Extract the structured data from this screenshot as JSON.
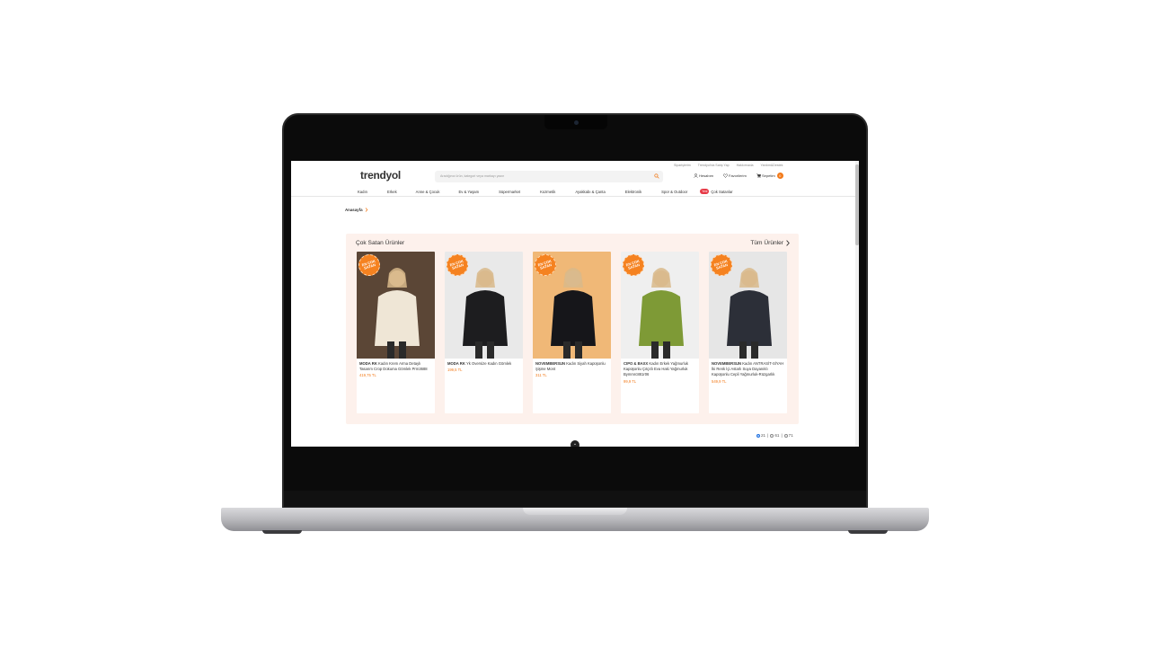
{
  "header": {
    "top_links": [
      "Siparişlerim",
      "Trendyol'da Satış Yap",
      "Hakkımızda",
      "Yardım&Destek"
    ],
    "logo": "trendyol",
    "search_placeholder": "Aradığınız ürün, kategori veya markayı yazın",
    "account": "Hesabım",
    "favorites": "Favorilerim",
    "cart": "Sepetim",
    "cart_count": "0"
  },
  "nav": {
    "items": [
      "Kadın",
      "Erkek",
      "Anne & Çocuk",
      "Ev & Yaşam",
      "Süpermarket",
      "Kozmetik",
      "Ayakkabı & Çanta",
      "Elektronik",
      "Spor & Outdoor"
    ],
    "badge": "Yeni",
    "last": "Çok Satanlar"
  },
  "breadcrumb": "Anasayfa",
  "best_sellers": {
    "title": "Çok Satan Ürünler",
    "all_link": "Tüm Ürünler",
    "seal_text": "EN ÇOK SATAN",
    "products": [
      {
        "brand": "MODA RK",
        "name": "Kadın Krem Arma Detaylı Tasarım Crop Dokuma Gömlek Prm3688",
        "price": "419,75 TL",
        "bg": "#5b4636",
        "outfit": "#efe6d6"
      },
      {
        "brand": "MODA RK",
        "name": "Yk Oversize Kadın Gömlek",
        "price": "199,5 TL",
        "bg": "#e9e9e9",
        "outfit": "#1d1d1f"
      },
      {
        "brand": "NOVEMBERSUN",
        "name": "Kadın Siyah Kapüşonlu Şişme Mont",
        "price": "311 TL",
        "bg": "#f0b877",
        "outfit": "#16161a"
      },
      {
        "brand": "CIPO & BAXX",
        "name": "Kadın Erkek Yağmurluk Kapüşonlu Çıtçıtlı Eva Haki Yağmurluk Bymmrc881r06",
        "price": "99,9 TL",
        "bg": "#efefef",
        "outfit": "#7e9a36"
      },
      {
        "brand": "NOVEMBERSUN",
        "name": "Kadın ANTRASİT-SİYAH İki Renk İçi Astarlı Suya Dayanıklı Kapüşonlu Cepli Yağmurluk-Rüzgarlık",
        "price": "549,9 TL",
        "bg": "#e6e6e6",
        "outfit": "#2c2f38"
      }
    ]
  },
  "pager": {
    "items": [
      "21",
      "61",
      "71"
    ],
    "selected": 0
  },
  "colors": {
    "accent": "#f27a1a",
    "best_bg": "#fdf1ec"
  }
}
